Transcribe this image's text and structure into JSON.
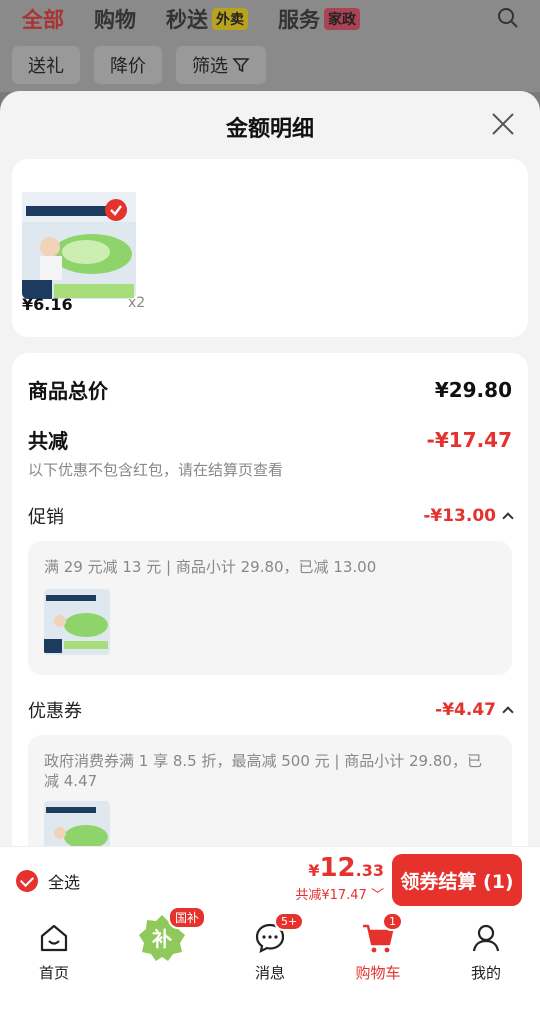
{
  "header": {
    "tabs": [
      {
        "label": "全部",
        "badge": ""
      },
      {
        "label": "购物",
        "badge": ""
      },
      {
        "label": "秒送",
        "badge": "外卖"
      },
      {
        "label": "服务",
        "badge": "家政"
      }
    ],
    "chips": [
      "送礼",
      "降价",
      "筛选"
    ]
  },
  "sheet": {
    "title": "金额明细",
    "product": {
      "price": "¥6.16",
      "qty": "x2"
    },
    "total_label": "商品总价",
    "total_value": "¥29.80",
    "discount_label": "共减",
    "discount_value": "-¥17.47",
    "discount_note": "以下优惠不包含红包，请在结算页查看",
    "promo": {
      "label": "促销",
      "value": "-¥13.00",
      "detail": "满 29 元减 13 元 | 商品小计 29.80，已减 13.00"
    },
    "coupon": {
      "label": "优惠券",
      "value": "-¥4.47",
      "detail": "政府消费券满 1 享 8.5 折，最高减 500 元 | 商品小计 29.80，已减 4.47"
    }
  },
  "checkout": {
    "select_all": "全选",
    "currency": "¥",
    "price_int": "12",
    "price_dec": ".33",
    "discount_summary": "共减¥17.47",
    "pay_button": "领券结算 (1)"
  },
  "tabbar": {
    "items": [
      {
        "label": "首页",
        "badge": ""
      },
      {
        "label": "",
        "badge": "国补"
      },
      {
        "label": "消息",
        "badge": "5+"
      },
      {
        "label": "购物车",
        "badge": "1"
      },
      {
        "label": "我的",
        "badge": ""
      }
    ],
    "subsidy_glyph": "补"
  },
  "colors": {
    "accent": "#e5322d"
  }
}
